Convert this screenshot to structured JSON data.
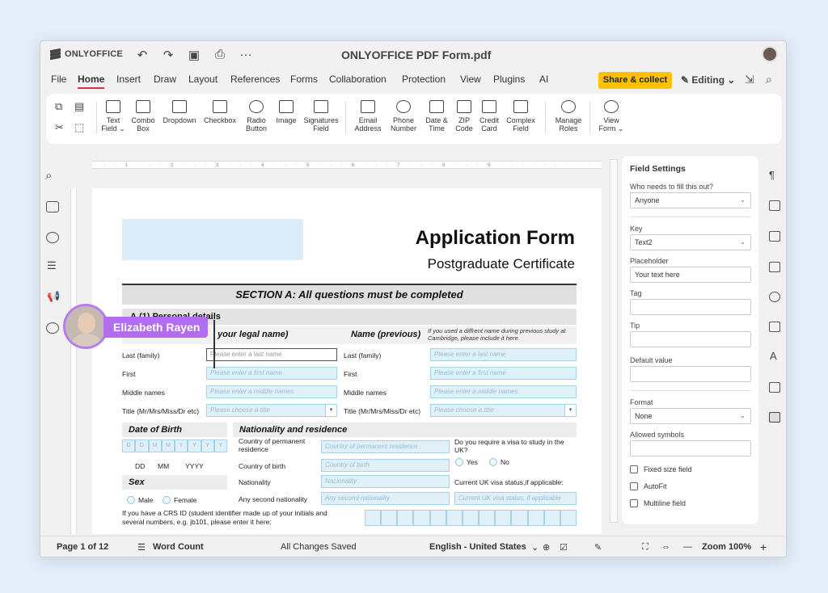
{
  "app": {
    "brand": "ONLYOFFICE",
    "doc_title": "ONLYOFFICE PDF Form.pdf"
  },
  "quick_access": {
    "undo": "↶",
    "redo": "↷",
    "save": "▣",
    "print": "⎙",
    "more": "···"
  },
  "menu": [
    "File",
    "Home",
    "Insert",
    "Draw",
    "Layout",
    "References",
    "Forms",
    "Collaboration",
    "Protection",
    "View",
    "Plugins",
    "AI"
  ],
  "active_menu": "Home",
  "share_label": "Share & collect",
  "editing_label": "Editing",
  "accent_color": "#e12b4b",
  "share_color": "#ffc200",
  "toolbar": [
    {
      "label": "Text\nField ⌄",
      "icon": "text-field-icon"
    },
    {
      "label": "Combo\nBox",
      "icon": "combo-box-icon"
    },
    {
      "label": "Dropdown",
      "icon": "dropdown-icon"
    },
    {
      "label": "Checkbox",
      "icon": "checkbox-icon"
    },
    {
      "label": "Radio\nButton",
      "icon": "radio-button-icon"
    },
    {
      "label": "Image",
      "icon": "image-icon"
    },
    {
      "label": "Signatures\nField",
      "icon": "signature-icon"
    },
    {
      "label": "Email\nAddress",
      "icon": "email-icon"
    },
    {
      "label": "Phone\nNumber",
      "icon": "phone-icon"
    },
    {
      "label": "Date &\nTime",
      "icon": "calendar-icon"
    },
    {
      "label": "ZIP\nCode",
      "icon": "zip-icon"
    },
    {
      "label": "Credit\nCard",
      "icon": "credit-card-icon"
    },
    {
      "label": "Complex\nField",
      "icon": "complex-field-icon"
    },
    {
      "label": "Manage\nRoles",
      "icon": "roles-icon"
    },
    {
      "label": "View\nForm ⌄",
      "icon": "eye-icon"
    }
  ],
  "form": {
    "title": "Application Form",
    "subtitle": "Postgraduate Certificate",
    "section_a": "SECTION A: All questions must be completed",
    "subheading": "A.(1) Personal details",
    "name_current": "your legal name)",
    "name_previous": "Name (previous)",
    "prev_note": "If you used a diffrent name during previous study at Cambridge, please include it here.",
    "labels": {
      "last": "Last (family)",
      "first": "First",
      "middle": "Middle names",
      "title": "Title (Mr/Mrs/Miss/Dr etc)"
    },
    "placeholders": {
      "last": "Please enter a last name",
      "first": "Please enter a first name",
      "middle": "Please enter a middle names",
      "title": "Please choose a title"
    },
    "dob_heading": "Date of Birth",
    "dob_cells": [
      "D",
      "D",
      "M",
      "M",
      "Y",
      "Y",
      "Y",
      "Y"
    ],
    "dob_parts": {
      "dd": "DD",
      "mm": "MM",
      "yyyy": "YYYY"
    },
    "nat_heading": "Nationality and residence",
    "country_perm": "Country of permanent residence",
    "country_perm_ph": "Country of permanent residence",
    "country_birth": "Country of birth",
    "country_birth_ph": "Country of birth",
    "nationality": "Nationality",
    "nationality_ph": "Nacionality",
    "second_nat": "Any second nationality",
    "second_nat_ph": "Any second nationality",
    "visa_q": "Do you require a visa to study in the UK?",
    "yes": "Yes",
    "no": "No",
    "visa_status": "Current UK visa status,if applicable:",
    "visa_status_ph": "Current UK visa status, if applicable",
    "sex_heading": "Sex",
    "male": "Male",
    "female": "Female",
    "crs_note": "If you have a CRS ID (student identifier made up of your initials and several numbers, e.g. jb101, please enter it here:"
  },
  "collaborator": {
    "name": "Elizabeth Rayen",
    "color": "#b26cf0"
  },
  "field_settings": {
    "title": "Field Settings",
    "who_label": "Who needs to fill this out?",
    "who_value": "Anyone",
    "key_label": "Key",
    "key_value": "Text2",
    "placeholder_label": "Placeholder",
    "placeholder_value": "Your text here",
    "tag_label": "Tag",
    "tip_label": "Tip",
    "default_label": "Default value",
    "format_label": "Format",
    "format_value": "None",
    "allowed_label": "Allowed symbols",
    "fixed_size": "Fixed size field",
    "autofit": "AutoFit",
    "multiline": "Multiline field"
  },
  "status": {
    "page": "Page 1 of 12",
    "word_count": "Word Count",
    "saved": "All Changes Saved",
    "language": "English - United States",
    "zoom": "Zoom 100%"
  }
}
